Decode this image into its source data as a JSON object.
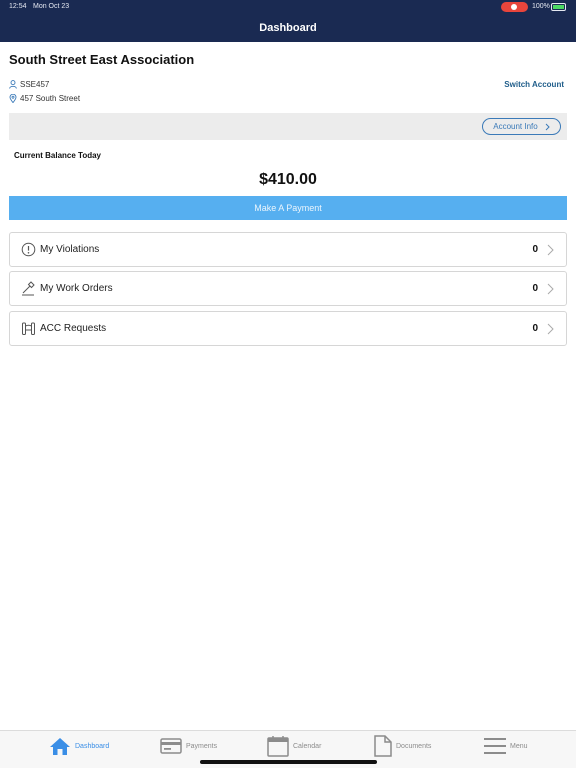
{
  "status_bar": {
    "time": "12:54",
    "date": "Mon Oct 23",
    "battery_percent": "100%"
  },
  "nav": {
    "title": "Dashboard"
  },
  "account": {
    "association_name": "South Street East Association",
    "account_id": "SSE457",
    "address": "457 South Street",
    "switch_account_label": "Switch Account",
    "account_info_label": "Account Info"
  },
  "balance": {
    "label": "Current Balance Today",
    "amount": "$410.00",
    "pay_button_label": "Make A Payment"
  },
  "items": [
    {
      "label": "My Violations",
      "count": "0",
      "icon": "alert-circle-icon"
    },
    {
      "label": "My Work Orders",
      "count": "0",
      "icon": "hammer-icon"
    },
    {
      "label": "ACC Requests",
      "count": "0",
      "icon": "gate-icon"
    }
  ],
  "tabs": [
    {
      "label": "Dashboard",
      "icon": "home-icon",
      "active": true
    },
    {
      "label": "Payments",
      "icon": "credit-card-icon",
      "active": false
    },
    {
      "label": "Calendar",
      "icon": "calendar-icon",
      "active": false
    },
    {
      "label": "Documents",
      "icon": "document-icon",
      "active": false
    },
    {
      "label": "Menu",
      "icon": "hamburger-menu-icon",
      "active": false
    }
  ],
  "colors": {
    "nav_bg": "#1a2a52",
    "accent": "#3a8ee6",
    "pay_button": "#56aff0",
    "link": "#1f5d8a"
  }
}
